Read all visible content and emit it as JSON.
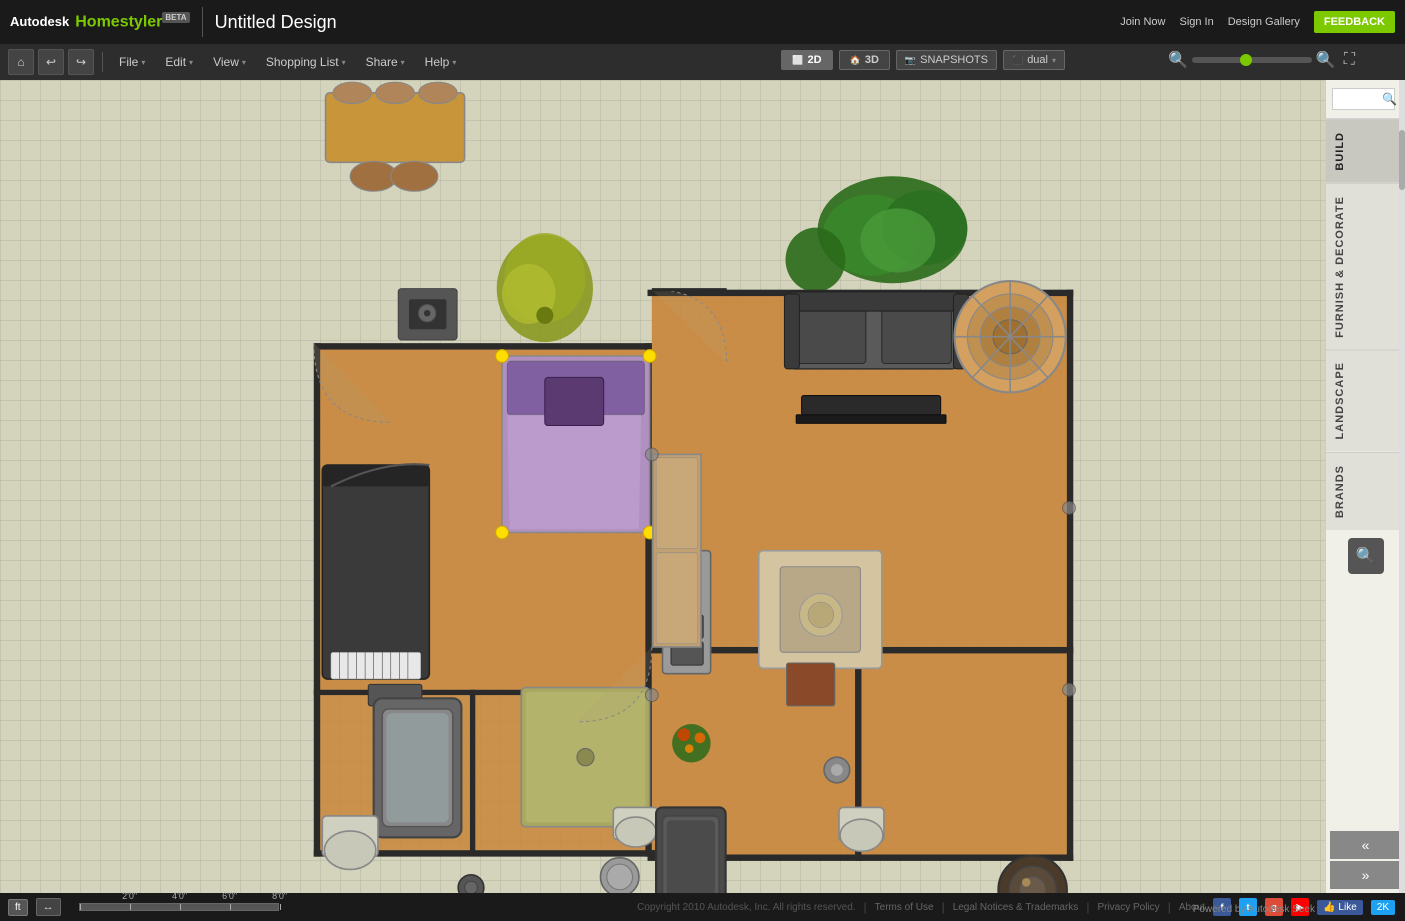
{
  "app": {
    "name": "Autodesk",
    "product": "Homestyler",
    "beta_label": "BETA",
    "title": "Untitled Design"
  },
  "top_nav": {
    "join_now": "Join Now",
    "sign_in": "Sign In",
    "design_gallery": "Design Gallery",
    "feedback": "FEEDBACK"
  },
  "toolbar": {
    "home_icon": "⌂",
    "undo_icon": "↩",
    "redo_icon": "↪",
    "menus": [
      {
        "label": "File",
        "has_arrow": true
      },
      {
        "label": "Edit",
        "has_arrow": true
      },
      {
        "label": "View",
        "has_arrow": true
      },
      {
        "label": "Shopping List",
        "has_arrow": true
      },
      {
        "label": "Share",
        "has_arrow": true
      },
      {
        "label": "Help",
        "has_arrow": true
      }
    ],
    "view_2d": "2D",
    "view_3d": "3D",
    "snapshots": "SNAPSHOTS",
    "dual": "dual"
  },
  "right_panel": {
    "search_placeholder": "",
    "tabs": [
      {
        "id": "build",
        "label": "BUILD"
      },
      {
        "id": "furnish",
        "label": "FURNISH & DECORATE"
      },
      {
        "id": "landscape",
        "label": "LANDSCAPE"
      },
      {
        "id": "brands",
        "label": "BRANDS"
      }
    ]
  },
  "bottom_bar": {
    "unit": "ft",
    "measure_icon": "↔",
    "scale_labels": [
      "2'0\"",
      "4'0\"",
      "6'0\"",
      "8'0\""
    ],
    "copyright": "Copyright 2010 Autodesk, Inc. All rights reserved.",
    "terms": "Terms of Use",
    "legal": "Legal Notices & Trademarks",
    "privacy": "Privacy Policy",
    "about": "About",
    "like_label": "Like",
    "like_count": "2K"
  },
  "powered_by": "Powered by Autodesk Seek",
  "colors": {
    "accent": "#7dc900",
    "header_bg": "#1a1a1a",
    "toolbar_bg": "#2d2d2d",
    "panel_bg": "#f0f0e8",
    "wood_floor": "#c8853a",
    "tile_floor": "#c8b898",
    "wall": "#333333"
  }
}
